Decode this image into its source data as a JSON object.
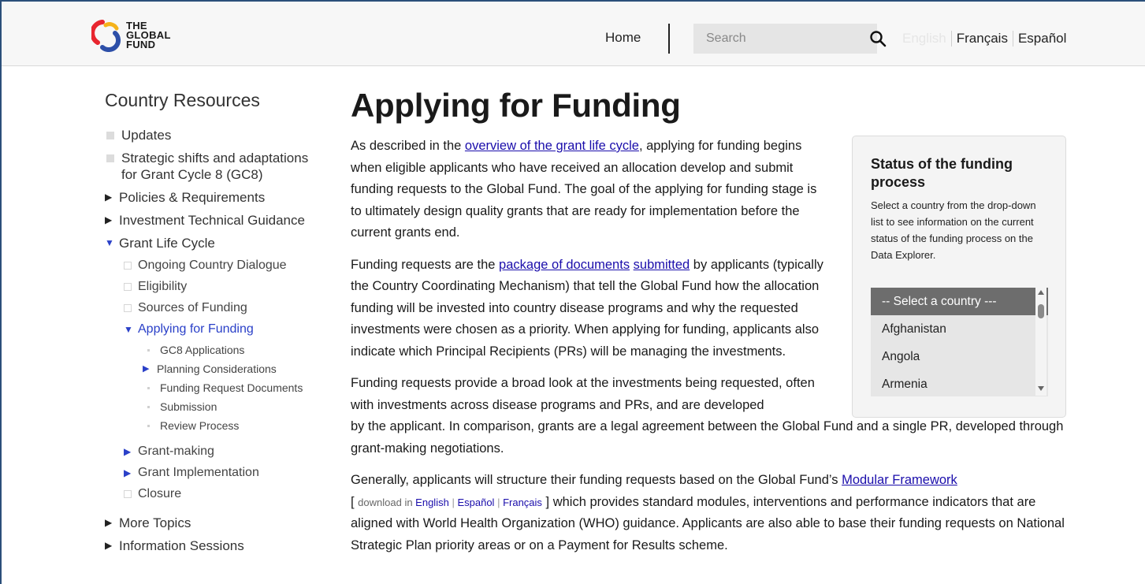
{
  "header": {
    "logo_text": [
      "THE",
      "GLOBAL",
      "FUND"
    ],
    "home_label": "Home",
    "search_placeholder": "Search",
    "languages": [
      "English",
      "Français",
      "Español"
    ],
    "active_language": "English"
  },
  "sidebar": {
    "title": "Country Resources",
    "items": [
      {
        "label": "Updates"
      },
      {
        "label": "Strategic shifts and adaptations for Grant Cycle 8 (GC8)"
      },
      {
        "label": "Policies & Requirements"
      },
      {
        "label": "Investment Technical Guidance"
      },
      {
        "label": "Grant Life Cycle"
      },
      {
        "label": "More Topics"
      },
      {
        "label": "Information Sessions"
      }
    ],
    "grant_life_cycle": [
      {
        "label": "Ongoing Country Dialogue"
      },
      {
        "label": "Eligibility"
      },
      {
        "label": "Sources of Funding"
      },
      {
        "label": "Applying for Funding"
      },
      {
        "label": "Grant-making"
      },
      {
        "label": "Grant Implementation"
      },
      {
        "label": "Closure"
      }
    ],
    "applying_children": [
      {
        "label": "GC8 Applications"
      },
      {
        "label": "Planning Considerations"
      },
      {
        "label": "Funding Request Documents"
      },
      {
        "label": "Submission"
      },
      {
        "label": "Review Process"
      }
    ]
  },
  "main": {
    "title": "Applying for Funding",
    "p1_a": "As described in the ",
    "p1_link": "overview of the grant life cycle",
    "p1_b": ", applying for funding begins when eligible applicants who have received an allocation develop and submit funding requests to the Global Fund. The goal of the applying for funding stage is to ultimately design quality grants that are ready for implementation before the current grants end.",
    "p2_a": "Funding requests are the ",
    "p2_link1": "package of documents",
    "p2_link2": "submitted",
    "p2_b": " by applicants (typically the Country Coordinating Mechanism) that tell the Global Fund how the allocation funding will be invested into country disease programs and why the requested investments were chosen as a priority. When applying for funding, applicants also indicate which Principal Recipients (PRs) will be managing the investments.",
    "p3_a": "Funding requests provide a broad look at the investments being requested, often with investments across disease programs and PRs, and are developed",
    "p3_b": "by the applicant. In comparison, grants are a legal agreement between the Global Fund and a single PR, developed through grant-making negotiations.",
    "p4_a": "Generally, applicants will structure their funding requests based on the Global Fund’s ",
    "p4_link": "Modular Framework",
    "p4_dl_open": "[ ",
    "p4_dl_text": "download in ",
    "p4_dl_links": [
      "English",
      "Español",
      "Français"
    ],
    "p4_dl_close": " ]",
    "p4_b": " which provides standard modules, interventions and performance indicators that are aligned with World Health Organization (WHO) guidance. Applicants are also able to base their funding requests on National Strategic Plan priority areas or on a Payment for Results scheme."
  },
  "status_box": {
    "title": "Status of the funding process",
    "description": "Select a country from the drop-down list to see information on the current status of the funding process on the Data Explorer.",
    "options": [
      "-- Select a country ---",
      "Afghanistan",
      "Angola",
      "Armenia"
    ]
  },
  "colors": {
    "link": "#1a0dab",
    "nav_active_blue": "#2a40c8",
    "header_bg": "#f7f7f7",
    "selected_option_bg": "#6d6d6d"
  }
}
